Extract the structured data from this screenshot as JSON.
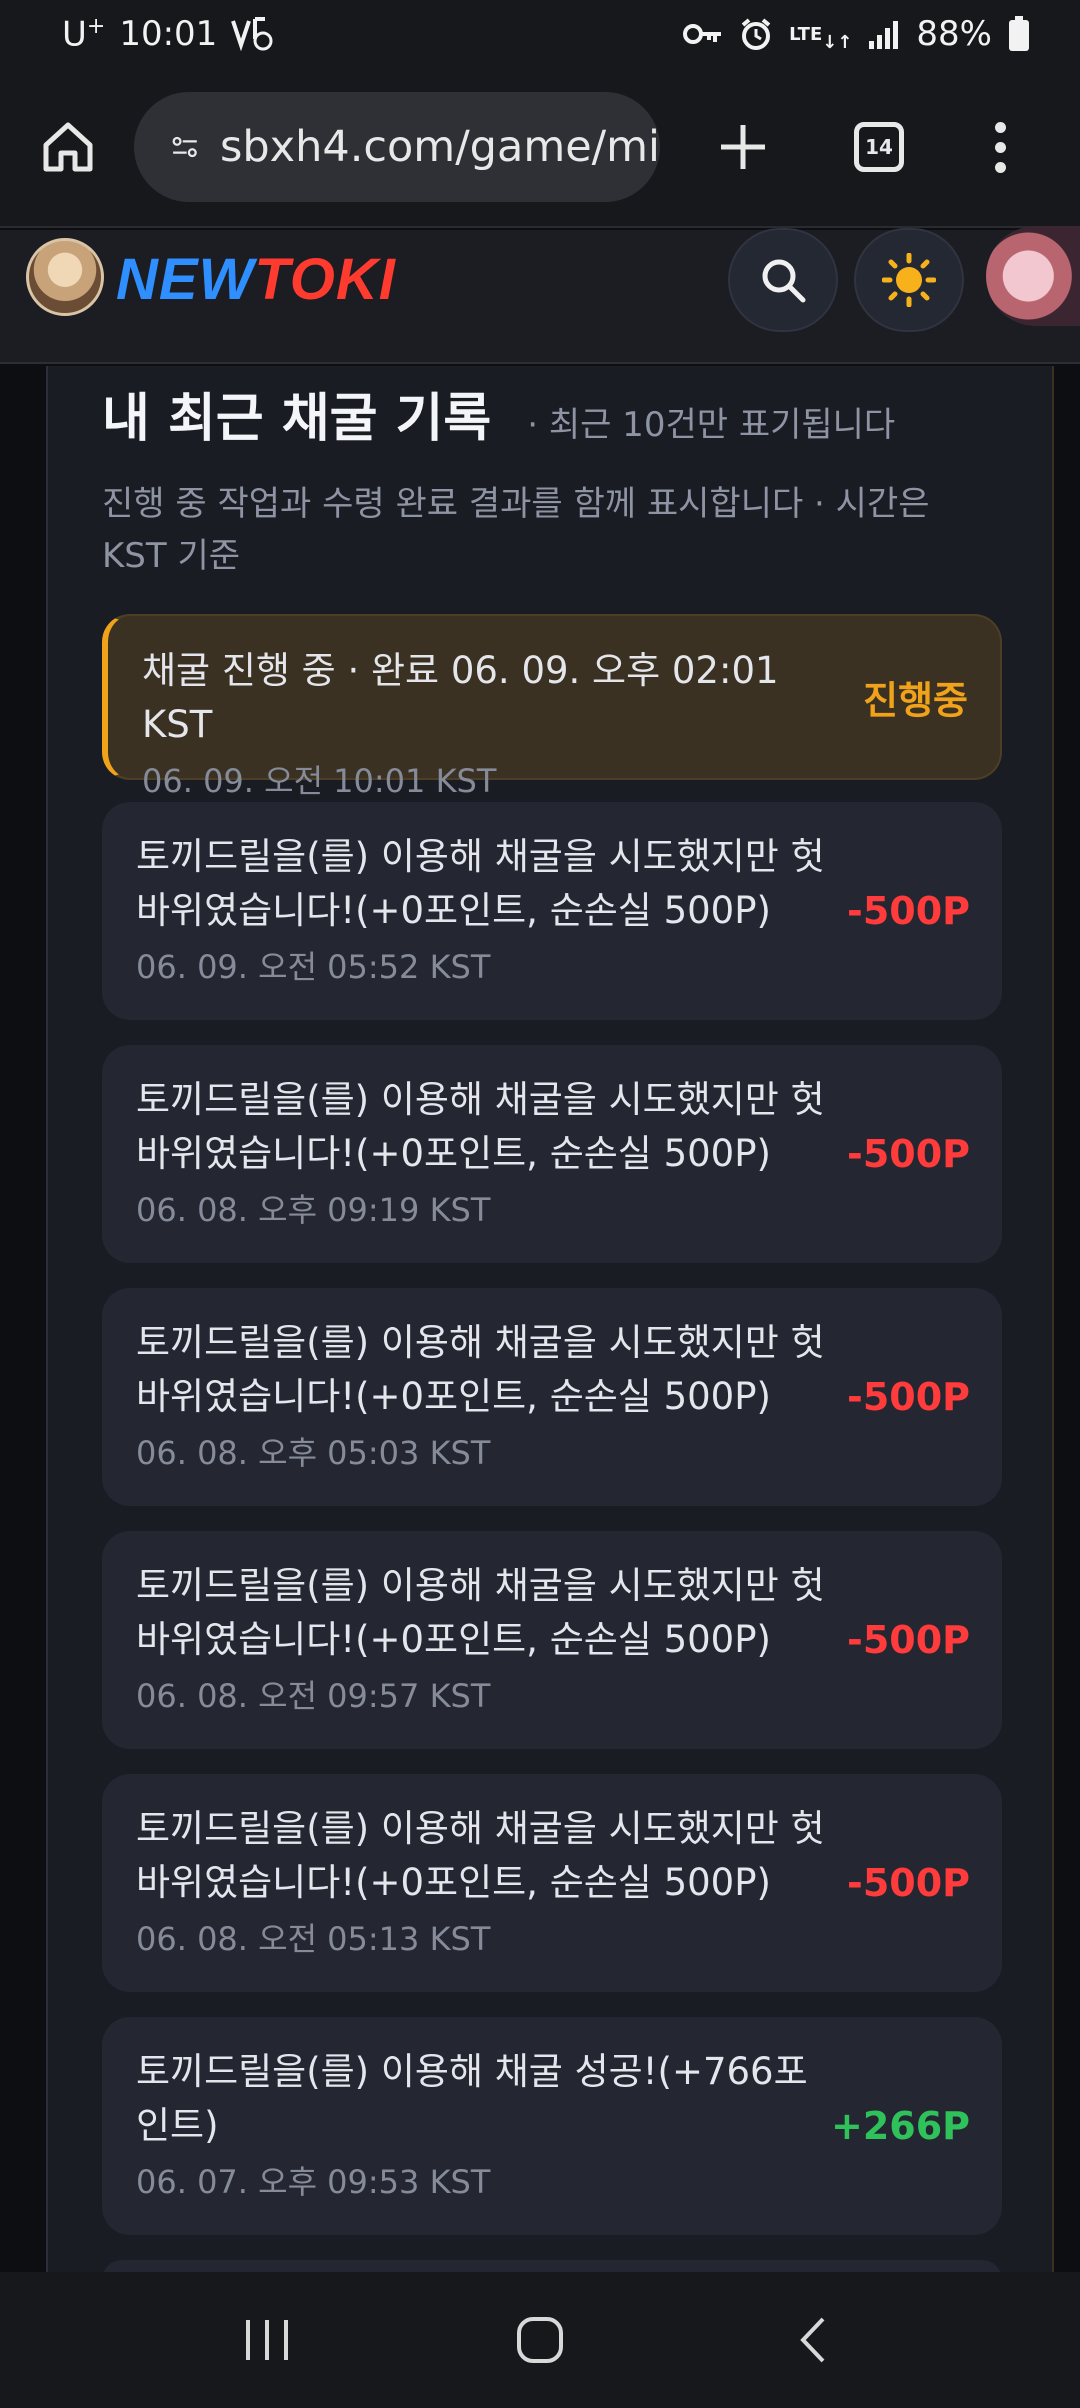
{
  "status_bar": {
    "carrier": "U",
    "carrier_sup": "+",
    "time": "10:01",
    "network": "LTE",
    "battery": "88%"
  },
  "browser": {
    "url": "sbxh4.com/game/mi",
    "tab_count": "14"
  },
  "site": {
    "logo_new": "NEW",
    "logo_toki": "TOKI"
  },
  "section": {
    "title": "내 최근 채굴 기록",
    "subtitle": "· 최근 10건만 표기됩니다",
    "description": "진행 중 작업과 수령 완료 결과를 함께 표시합니다 · 시간은 KST 기준"
  },
  "records": [
    {
      "message": "채굴 진행 중 · 완료 06. 09. 오후 02:01 KST",
      "time": "06. 09. 오전 10:01 KST",
      "amount": "진행중",
      "status": "ongoing"
    },
    {
      "message": "토끼드릴을(를) 이용해 채굴을 시도했지만 헛바위였습니다!(+0포인트, 순손실 500P)",
      "time": "06. 09. 오전 05:52 KST",
      "amount": "-500P",
      "status": "loss"
    },
    {
      "message": "토끼드릴을(를) 이용해 채굴을 시도했지만 헛바위였습니다!(+0포인트, 순손실 500P)",
      "time": "06. 08. 오후 09:19 KST",
      "amount": "-500P",
      "status": "loss"
    },
    {
      "message": "토끼드릴을(를) 이용해 채굴을 시도했지만 헛바위였습니다!(+0포인트, 순손실 500P)",
      "time": "06. 08. 오후 05:03 KST",
      "amount": "-500P",
      "status": "loss"
    },
    {
      "message": "토끼드릴을(를) 이용해 채굴을 시도했지만 헛바위였습니다!(+0포인트, 순손실 500P)",
      "time": "06. 08. 오전 09:57 KST",
      "amount": "-500P",
      "status": "loss"
    },
    {
      "message": "토끼드릴을(를) 이용해 채굴을 시도했지만 헛바위였습니다!(+0포인트, 순손실 500P)",
      "time": "06. 08. 오전 05:13 KST",
      "amount": "-500P",
      "status": "loss"
    },
    {
      "message": "토끼드릴을(를) 이용해 채굴 성공!(+766포인트)",
      "time": "06. 07. 오후 09:53 KST",
      "amount": "+266P",
      "status": "gain"
    }
  ],
  "colors": {
    "ongoing": "#f0a21a",
    "loss": "#ff3b3b",
    "gain": "#2fc15a"
  }
}
